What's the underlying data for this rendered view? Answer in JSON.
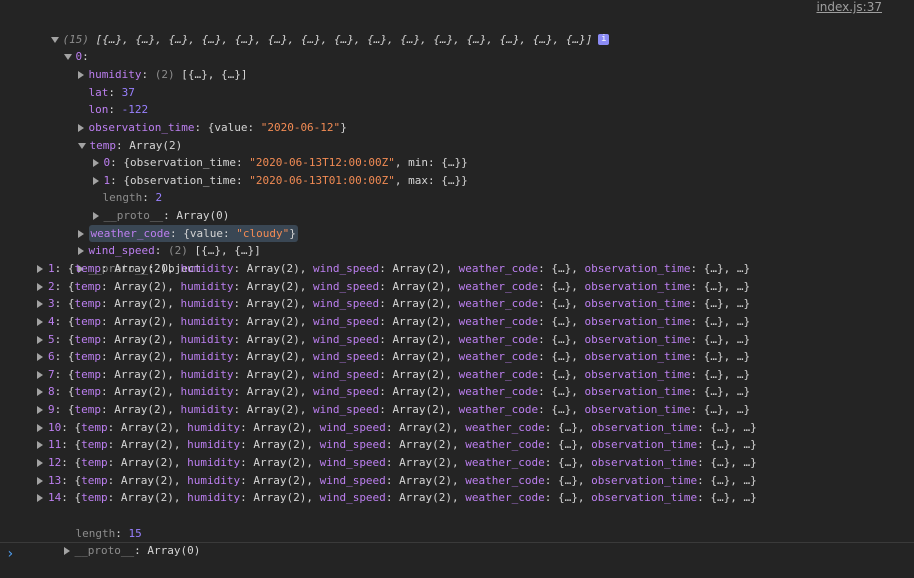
{
  "source_link": "index.js:37",
  "root": {
    "count": "(15)",
    "summary": "[{…}, {…}, {…}, {…}, {…}, {…}, {…}, {…}, {…}, {…}, {…}, {…}, {…}, {…}, {…}]",
    "info": "i"
  },
  "item0": {
    "index": "0",
    "humidity": {
      "key": "humidity",
      "count": "(2)",
      "value": "[{…}, {…}]"
    },
    "lat": {
      "key": "lat",
      "value": "37"
    },
    "lon": {
      "key": "lon",
      "value": "-122"
    },
    "observation_time": {
      "key": "observation_time",
      "pre": "{value: ",
      "str": "\"2020-06-12\"",
      "post": "}"
    },
    "temp": {
      "key": "temp",
      "value": "Array(2)",
      "children": [
        {
          "idx": "0",
          "pre": "{observation_time: ",
          "str": "\"2020-06-13T12:00:00Z\"",
          "post": ", min: {…}}"
        },
        {
          "idx": "1",
          "pre": "{observation_time: ",
          "str": "\"2020-06-13T01:00:00Z\"",
          "post": ", max: {…}}"
        }
      ],
      "length_key": "length",
      "length_value": "2",
      "proto_key": "__proto__",
      "proto_value": "Array(0)"
    },
    "weather_code": {
      "key": "weather_code",
      "pre": "{value: ",
      "str": "\"cloudy\"",
      "post": "}"
    },
    "wind_speed": {
      "key": "wind_speed",
      "count": "(2)",
      "value": "[{…}, {…}]"
    },
    "proto": {
      "key": "__proto__",
      "value": "Object"
    }
  },
  "rows": [
    {
      "idx": "1"
    },
    {
      "idx": "2"
    },
    {
      "idx": "3"
    },
    {
      "idx": "4"
    },
    {
      "idx": "5"
    },
    {
      "idx": "6"
    },
    {
      "idx": "7"
    },
    {
      "idx": "8"
    },
    {
      "idx": "9"
    },
    {
      "idx": "10"
    },
    {
      "idx": "11"
    },
    {
      "idx": "12"
    },
    {
      "idx": "13"
    },
    {
      "idx": "14"
    }
  ],
  "row_template": {
    "temp": "temp",
    "temp_val": "Array(2)",
    "humidity": "humidity",
    "humidity_val": "Array(2)",
    "wind_speed": "wind_speed",
    "wind_speed_val": "Array(2)",
    "weather_code": "weather_code",
    "weather_code_val": "{…}",
    "observation_time": "observation_time",
    "observation_time_val": "{…}",
    "ellipsis": "…"
  },
  "length": {
    "key": "length",
    "value": "15"
  },
  "proto": {
    "key": "__proto__",
    "value": "Array(0)"
  },
  "prompt": "›"
}
